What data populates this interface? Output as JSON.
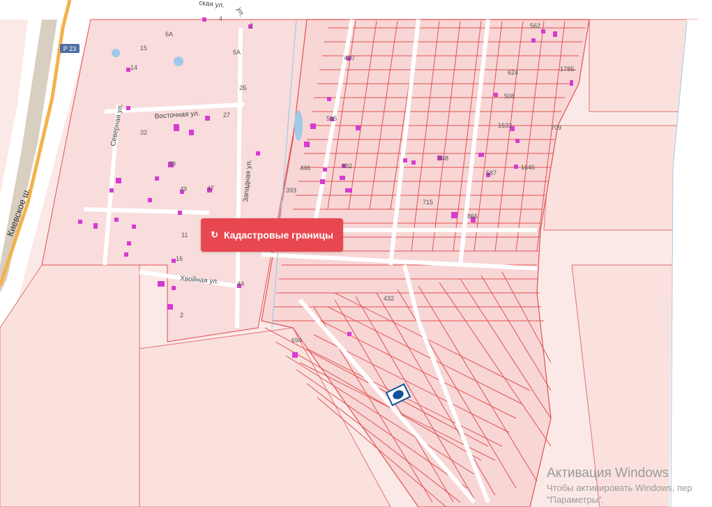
{
  "map": {
    "highway_shield": "Р 23",
    "highway_name": "Киевское ш.",
    "streets": {
      "vostochnaya": "Восточная ул.",
      "severnaya": "Северная ул.",
      "zapadnaya": "Западная ул.",
      "khvoynaya": "Хвойная ул.",
      "top_street": "ская ул.",
      "top_street_2": "ул."
    },
    "labels": {
      "n4": "4",
      "n6a": "6А",
      "n2": "2",
      "n15": "15",
      "n5a": "5А",
      "n14": "14",
      "n2b": "2Б",
      "n27": "27",
      "n32": "32",
      "n39": "39",
      "n49": "49",
      "n47": "47",
      "n11": "11",
      "n16": "16",
      "n2b2": "2",
      "n44": "44",
      "n562": "562",
      "n178b": "178Б",
      "n624": "624",
      "n508": "508",
      "n709": "709",
      "n1633": "1633",
      "n1646": "1646",
      "n587": "587",
      "n848": "848",
      "n490": "490",
      "n595": "595",
      "n446": "446",
      "n492": "492",
      "n393": "393",
      "n715": "715",
      "n866": "866",
      "n432": "432",
      "n694": "694"
    },
    "colors": {
      "parcel_fill": "#f6d6d6",
      "parcel_border": "#e05050",
      "building": "#d63bd0",
      "road": "#ffffff",
      "highway": "#f4b24a",
      "water": "#9ec9e8"
    }
  },
  "overlay": {
    "cadastral_button": "Кадастровые границы",
    "refresh_icon": "refresh-icon"
  },
  "watermark": {
    "line1": "Активация Windows",
    "line2": "Чтобы активировать Windows, пер",
    "line3": "\"Параметры\"."
  }
}
